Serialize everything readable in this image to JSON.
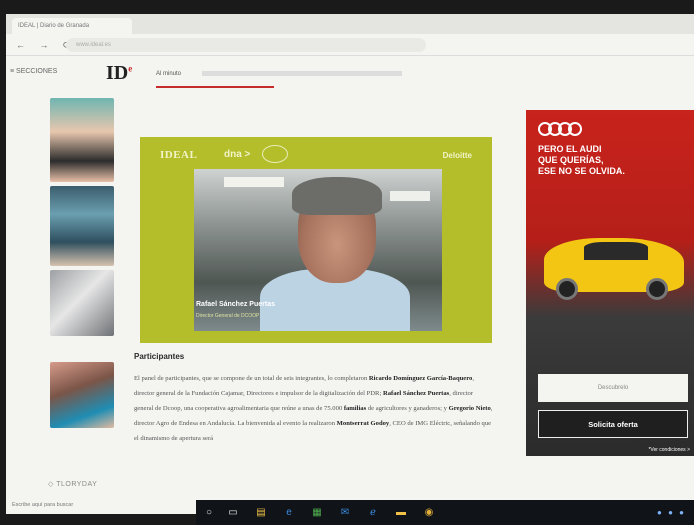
{
  "browser": {
    "tab_title": "IDEAL | Diario de Granada",
    "url": "www.ideal.es",
    "nav_icons": "← → ⟳"
  },
  "site": {
    "menu_label": "SECCIONES",
    "logo_main": "ID",
    "logo_sup": "e",
    "section_label": "Al minuto"
  },
  "video_card": {
    "brand_left": "IDEAL",
    "brand_mid": "dna >",
    "brand_right": "Deloitte",
    "speaker_name": "Rafael Sánchez Puertas",
    "speaker_role": "Director General de DCOOP"
  },
  "sidebar": {
    "promo_label": "◇ TLORYDAY"
  },
  "article": {
    "heading": "Participantes",
    "p1": "El panel de participantes, que se compone de un total de seis integrantes, lo completaron ",
    "b1": "Ricardo Domínguez García-Baquero",
    "p2": ", director general de la Fundación Cajamar, Directores e impulsor de la digitalización del PDR; ",
    "b2": "Rafael Sánchez Puertas",
    "p3": ", director general de Dcoop, una cooperativa agroalimentaria que reúne a unas de 75.000 ",
    "b3": "familias",
    "p4": " de agricultores y ganaderos; y ",
    "b4": "Gregorio Nieto",
    "p5": ", director Agro de Endesa en Andalucía. La bienvenida al evento la realizaron ",
    "b5": "Montserrat Godoy",
    "p6": ", CEO de IMG Eléctric, señalando que el dinamismo de apertura será"
  },
  "ad": {
    "headline_line1": "PERO EL AUDI",
    "headline_line2": "QUE QUERÍAS,",
    "headline_line3": "ESE NO SE OLVIDA.",
    "discover_label": "Descubrelo",
    "cta_label": "Solicita oferta",
    "footnote": "*Ver condiciones >"
  },
  "status": {
    "text": "Escribe aquí para buscar"
  },
  "taskbar": {
    "start": "⊞",
    "search": "○",
    "taskview": "▭",
    "explorer": "▤",
    "edge": "e",
    "store": "▦",
    "mail": "✉",
    "ie": "ℯ",
    "files": "▬",
    "chrome": "◉",
    "tray": "● ● ●"
  }
}
